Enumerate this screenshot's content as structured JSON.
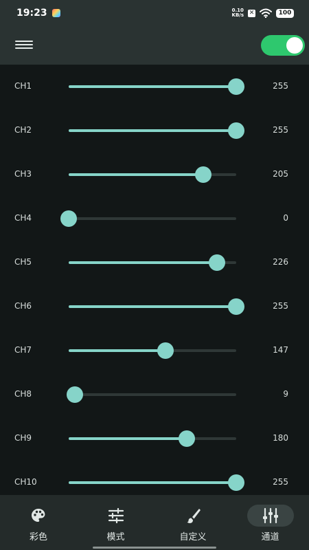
{
  "status_bar": {
    "time": "19:23",
    "net_speed_value": "0.10",
    "net_speed_unit": "KB/s",
    "battery": "100"
  },
  "toolbar": {
    "master_switch_on": true
  },
  "channels": [
    {
      "label": "CH1",
      "value": "255",
      "level": 255
    },
    {
      "label": "CH2",
      "value": "255",
      "level": 255
    },
    {
      "label": "CH3",
      "value": "205",
      "level": 205
    },
    {
      "label": "CH4",
      "value": "0",
      "level": 0
    },
    {
      "label": "CH5",
      "value": "226",
      "level": 226
    },
    {
      "label": "CH6",
      "value": "255",
      "level": 255
    },
    {
      "label": "CH7",
      "value": "147",
      "level": 147
    },
    {
      "label": "CH8",
      "value": "9",
      "level": 9
    },
    {
      "label": "CH9",
      "value": "180",
      "level": 180
    },
    {
      "label": "CH10",
      "value": "255",
      "level": 255
    }
  ],
  "channel_max": 255,
  "bottom_nav": [
    {
      "label": "彩色",
      "icon": "palette-icon",
      "active": false
    },
    {
      "label": "模式",
      "icon": "sliders-icon",
      "active": false
    },
    {
      "label": "自定义",
      "icon": "brush-icon",
      "active": false
    },
    {
      "label": "通道",
      "icon": "channels-icon",
      "active": true
    }
  ],
  "colors": {
    "accent": "#86d4c9",
    "switch_on": "#2ec86e",
    "background": "#121717",
    "bar": "#2a3332"
  }
}
